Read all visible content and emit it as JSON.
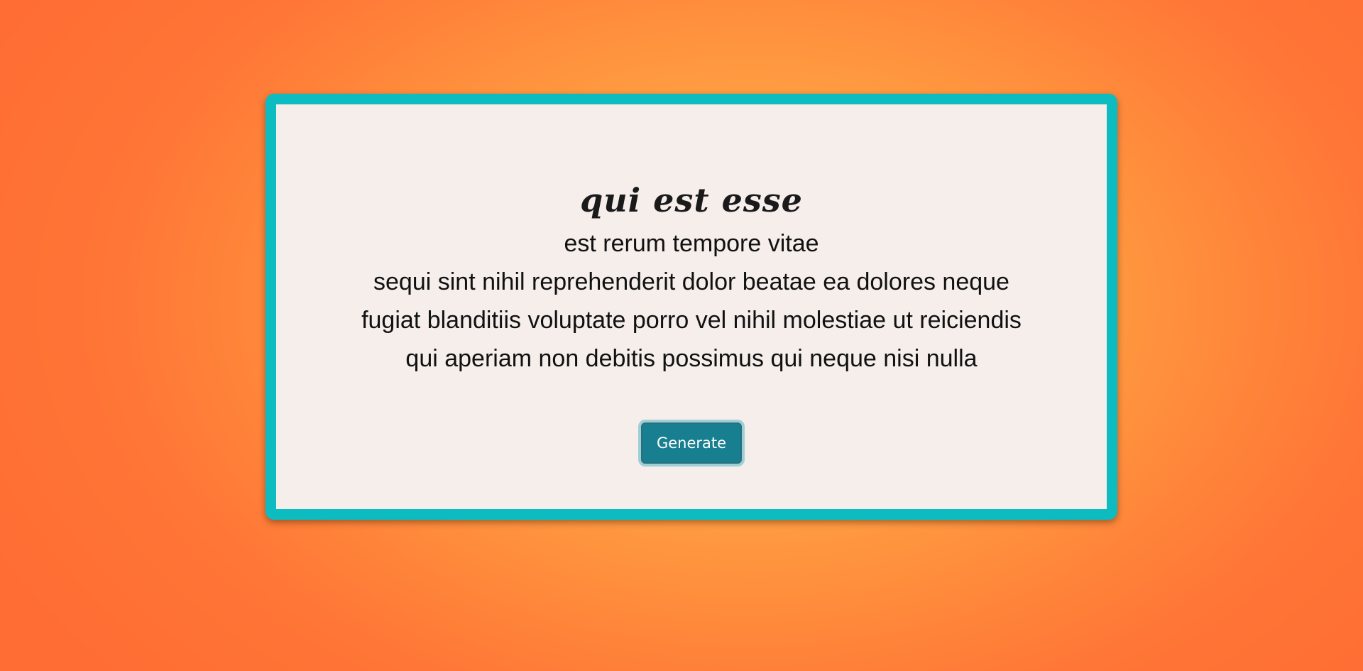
{
  "post": {
    "title": "qui est esse",
    "body": "est rerum tempore vitae\nsequi sint nihil reprehenderit dolor beatae ea dolores neque\nfugiat blanditiis voluptate porro vel nihil molestiae ut reiciendis\nqui aperiam non debitis possimus qui neque nisi nulla"
  },
  "controls": {
    "generate_label": "Generate"
  },
  "colors": {
    "frame_accent": "#0dbcc0",
    "card_background": "#f5eeeb",
    "button_background": "#177f8f",
    "page_background": "#ff9a40"
  }
}
